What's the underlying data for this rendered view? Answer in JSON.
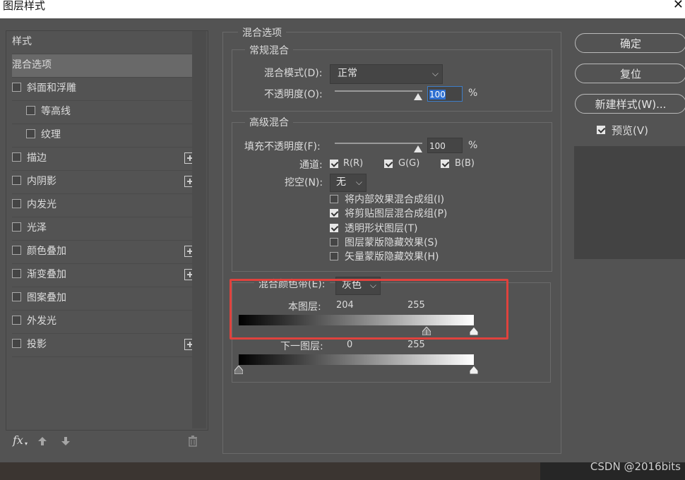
{
  "window": {
    "title": "图层样式",
    "close": "✕"
  },
  "left_panel": {
    "header": "样式",
    "items": [
      {
        "label": "混合选项",
        "selected": true,
        "checkbox": false,
        "plus": false
      },
      {
        "label": "斜面和浮雕",
        "checkbox": true,
        "plus": false
      },
      {
        "label": "等高线",
        "checkbox": true,
        "plus": false,
        "indent": true
      },
      {
        "label": "纹理",
        "checkbox": true,
        "plus": false,
        "indent": true
      },
      {
        "label": "描边",
        "checkbox": true,
        "plus": true
      },
      {
        "label": "内阴影",
        "checkbox": true,
        "plus": true
      },
      {
        "label": "内发光",
        "checkbox": true,
        "plus": false
      },
      {
        "label": "光泽",
        "checkbox": true,
        "plus": false
      },
      {
        "label": "颜色叠加",
        "checkbox": true,
        "plus": true
      },
      {
        "label": "渐变叠加",
        "checkbox": true,
        "plus": true
      },
      {
        "label": "图案叠加",
        "checkbox": true,
        "plus": false
      },
      {
        "label": "外发光",
        "checkbox": true,
        "plus": false
      },
      {
        "label": "投影",
        "checkbox": true,
        "plus": true
      }
    ],
    "footer": {
      "fx": "fx",
      "up_icon": "arrow-up-icon",
      "down_icon": "arrow-down-icon",
      "trash_icon": "trash-icon"
    }
  },
  "blend_options": {
    "title": "混合选项",
    "general": {
      "title": "常规混合",
      "mode_label": "混合模式(D):",
      "mode_value": "正常",
      "opacity_label": "不透明度(O):",
      "opacity_value": "100",
      "percent": "%"
    },
    "advanced": {
      "title": "高级混合",
      "fill_label": "填充不透明度(F):",
      "fill_value": "100",
      "percent": "%",
      "channels_label": "通道:",
      "channels": [
        {
          "label": "R(R)",
          "checked": true
        },
        {
          "label": "G(G)",
          "checked": true
        },
        {
          "label": "B(B)",
          "checked": true
        }
      ],
      "knockout_label": "挖空(N):",
      "knockout_value": "无",
      "options": [
        {
          "label": "将内部效果混合成组(I)",
          "checked": false
        },
        {
          "label": "将剪贴图层混合成组(P)",
          "checked": true
        },
        {
          "label": "透明形状图层(T)",
          "checked": true
        },
        {
          "label": "图层蒙版隐藏效果(S)",
          "checked": false
        },
        {
          "label": "矢量蒙版隐藏效果(H)",
          "checked": false
        }
      ]
    },
    "blend_if": {
      "label": "混合颜色带(E):",
      "value": "灰色",
      "this_layer_label": "本图层:",
      "this_layer_values": [
        "204",
        "255"
      ],
      "this_layer_fraction": [
        0.8,
        1.0
      ],
      "underlying_label": "下一图层:",
      "underlying_values": [
        "0",
        "255"
      ],
      "underlying_fraction": [
        0.0,
        1.0
      ]
    }
  },
  "buttons": {
    "ok": "确定",
    "reset": "复位",
    "new_style": "新建样式(W)...",
    "preview_label": "预览(V)",
    "preview_checked": true
  },
  "watermark": "CSDN @2016bits",
  "colors": {
    "highlight": "#e0423d",
    "panel": "#535353"
  }
}
